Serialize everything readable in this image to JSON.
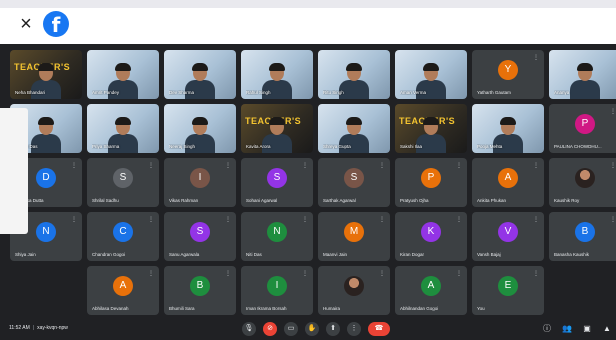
{
  "app": {
    "close_glyph": "×",
    "logo_letter": "f",
    "brand_color": "#1877f2"
  },
  "tiles": [
    {
      "type": "video",
      "poster": true,
      "poster_text": "TEACHER'S",
      "name": "Neha Bhandari"
    },
    {
      "type": "video",
      "name": "Amrit Pandey"
    },
    {
      "type": "video",
      "name": "Dev Sharma"
    },
    {
      "type": "video",
      "name": "Rahul Singh"
    },
    {
      "type": "video",
      "name": "Ritu Singh"
    },
    {
      "type": "video",
      "name": "Aman Verma"
    },
    {
      "type": "avatar",
      "letter": "Y",
      "color": "#e8710a",
      "name": "Yatharth Gautam"
    },
    {
      "type": "video",
      "name": "Ananya"
    },
    {
      "type": "video",
      "name": "Rohan Das"
    },
    {
      "type": "video",
      "name": "Priya Sharma"
    },
    {
      "type": "video",
      "name": "Neeraj Singh"
    },
    {
      "type": "video",
      "poster": true,
      "poster_text": "TEACHER'S",
      "name": "Kavita Arora"
    },
    {
      "type": "video",
      "name": "Shreya Gupta"
    },
    {
      "type": "video",
      "poster": true,
      "poster_text": "TEACHER'S",
      "name": "Sakshi Ilaa"
    },
    {
      "type": "video",
      "name": "Pooja Mehta"
    },
    {
      "type": "avatar",
      "letter": "P",
      "color": "#d01884",
      "name": "PAULINA CHOWDHU..."
    },
    {
      "type": "avatar",
      "letter": "D",
      "color": "#1a73e8",
      "name": "Deepika Dutta"
    },
    {
      "type": "avatar",
      "letter": "S",
      "color": "#5f6368",
      "name": "Shrilal Sadhu"
    },
    {
      "type": "avatar",
      "letter": "I",
      "color": "#795548",
      "name": "Vikas Rahman"
    },
    {
      "type": "avatar",
      "letter": "S",
      "color": "#9334e6",
      "name": "Sohani Agarwal"
    },
    {
      "type": "avatar",
      "letter": "S",
      "color": "#795548",
      "name": "Sarthak Agarwal"
    },
    {
      "type": "avatar",
      "letter": "P",
      "color": "#e8710a",
      "name": "Pratyush Ojha"
    },
    {
      "type": "avatar",
      "letter": "A",
      "color": "#e8710a",
      "name": "Ankita Phukan"
    },
    {
      "type": "photo",
      "name": "Kaushik Roy"
    },
    {
      "type": "avatar",
      "letter": "N",
      "color": "#1a73e8",
      "name": "Shiya Jain"
    },
    {
      "type": "avatar",
      "letter": "C",
      "color": "#1a73e8",
      "name": "Chandran Gogoi"
    },
    {
      "type": "avatar",
      "letter": "S",
      "color": "#9334e6",
      "name": "Sanu Agarwala"
    },
    {
      "type": "avatar",
      "letter": "N",
      "color": "#1e8e3e",
      "name": "Niti Das"
    },
    {
      "type": "avatar",
      "letter": "M",
      "color": "#e8710a",
      "name": "Maanvi Jain"
    },
    {
      "type": "avatar",
      "letter": "K",
      "color": "#9334e6",
      "name": "Kiran Dogar"
    },
    {
      "type": "avatar",
      "letter": "V",
      "color": "#9334e6",
      "name": "Vansh Bajaj"
    },
    {
      "type": "avatar",
      "letter": "B",
      "color": "#1a73e8",
      "name": "Banasha Kaushik"
    },
    {
      "type": "empty",
      "name": ""
    },
    {
      "type": "avatar",
      "letter": "A",
      "color": "#e8710a",
      "name": "Abhilasa Devanah"
    },
    {
      "type": "avatar",
      "letter": "B",
      "color": "#1e8e3e",
      "name": "Bhumili Sara"
    },
    {
      "type": "avatar",
      "letter": "I",
      "color": "#1e8e3e",
      "name": "Iman Ikrama Borsah"
    },
    {
      "type": "photo",
      "name": "Humaira"
    },
    {
      "type": "avatar",
      "letter": "A",
      "color": "#1e8e3e",
      "name": "Abhilnandan Gogoi"
    },
    {
      "type": "avatar",
      "letter": "E",
      "color": "#1e8e3e",
      "name": "You"
    }
  ],
  "bottom": {
    "time": "11:52 AM",
    "separator": "|",
    "meeting_code": "xay-kvqn-npw",
    "controls": [
      {
        "icon": "mic-icon",
        "glyph": "🎙",
        "red": false
      },
      {
        "icon": "camera-off-icon",
        "glyph": "⊘",
        "red": true
      },
      {
        "icon": "captions-icon",
        "glyph": "▭",
        "red": false
      },
      {
        "icon": "raise-hand-icon",
        "glyph": "✋",
        "red": false
      },
      {
        "icon": "present-icon",
        "glyph": "⬆",
        "red": false
      },
      {
        "icon": "more-options-icon",
        "glyph": "⋮",
        "red": false
      }
    ],
    "hangup_glyph": "☎",
    "right_icons": [
      {
        "icon": "info-icon",
        "glyph": "ⓘ"
      },
      {
        "icon": "people-icon",
        "glyph": "👥"
      },
      {
        "icon": "chat-icon",
        "glyph": "▣"
      },
      {
        "icon": "activities-icon",
        "glyph": "▲"
      }
    ]
  }
}
